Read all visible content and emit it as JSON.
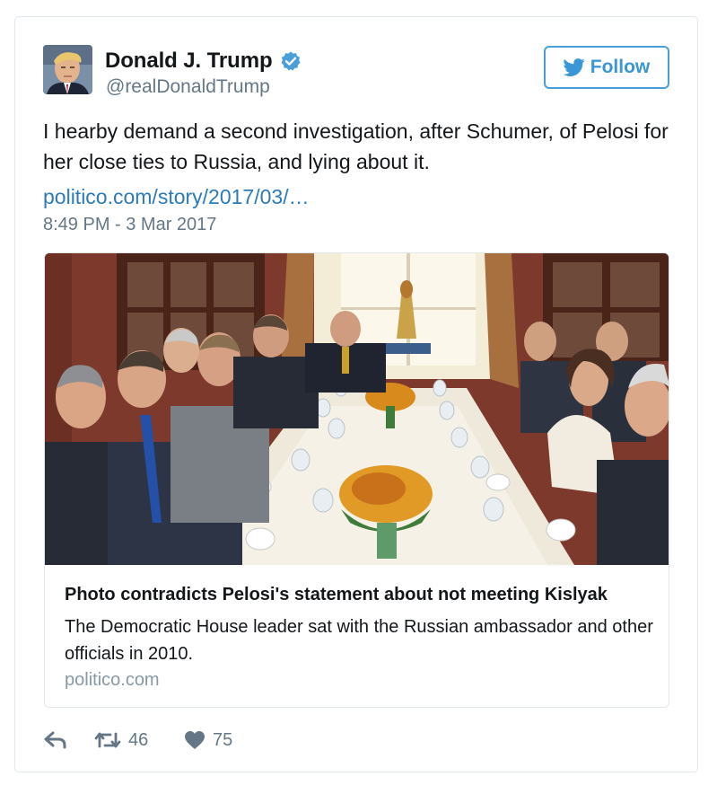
{
  "user": {
    "display_name": "Donald J. Trump",
    "handle": "@realDonaldTrump",
    "verified_icon": "verified-badge-icon",
    "verified_color": "#4a9fd8"
  },
  "follow_button": {
    "label": "Follow",
    "icon": "twitter-bird-icon",
    "color": "#3a96d6"
  },
  "tweet": {
    "text": "I hearby demand a second investigation, after Schumer, of Pelosi for her close ties to Russia, and lying about it.",
    "link": "politico.com/story/2017/03/…",
    "link_color": "#2b7bb9",
    "timestamp": "8:49 PM - 3 Mar 2017"
  },
  "card": {
    "title": "Photo contradicts Pelosi's statement about not meeting Kislyak",
    "description": "The Democratic House leader sat with the Russian ambassador and other officials in 2010.",
    "domain": "politico.com"
  },
  "actions": {
    "reply_icon": "reply-icon",
    "retweet_icon": "retweet-icon",
    "retweet_count": "46",
    "like_icon": "heart-icon",
    "like_count": "75"
  }
}
